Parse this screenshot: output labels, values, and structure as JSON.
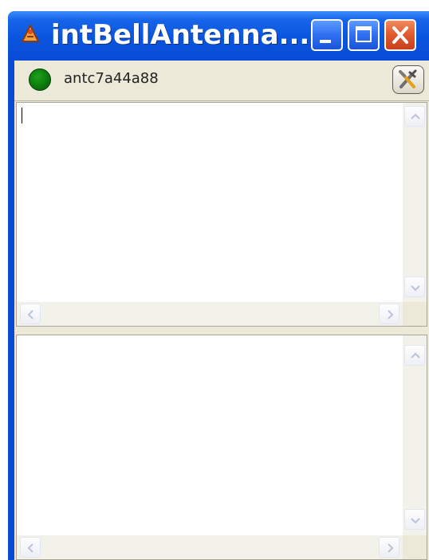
{
  "window": {
    "title": "intBellAntenna...",
    "app_icon": "antenna-app-icon",
    "controls": [
      "minimize-icon",
      "maximize-icon",
      "close-icon"
    ]
  },
  "status": {
    "indicator_color": "#0b7a0b",
    "name": "antc7a44a88",
    "tools_icon": "tools-icon"
  },
  "panes": {
    "top_scroll_icons": [
      "scroll-up-icon",
      "scroll-down-icon",
      "scroll-left-icon",
      "scroll-right-icon"
    ],
    "bottom_scroll_icons": [
      "scroll-up-icon",
      "scroll-down-icon",
      "scroll-left-icon",
      "scroll-right-icon"
    ]
  },
  "colors": {
    "titlebar": "#0a55dd",
    "close_button": "#e0582c",
    "frame": "#ece9d8"
  }
}
